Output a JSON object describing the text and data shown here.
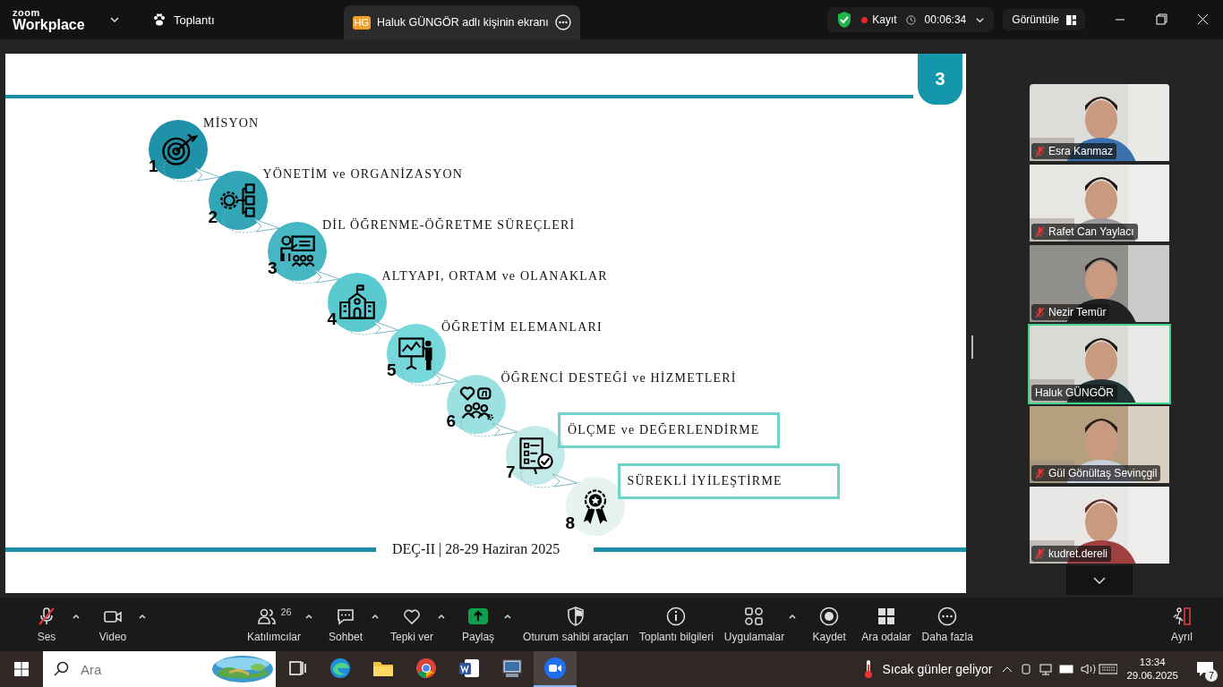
{
  "title_bar": {
    "brand": "zoom",
    "product": "Workplace",
    "meeting_menu": "Toplantı",
    "share_tab": {
      "initials": "HG",
      "label": "Haluk GÜNGÖR adlı kişinin ekranı"
    },
    "recording": {
      "label": "Kayıt",
      "elapsed": "00:06:34"
    },
    "view_button": "Görüntüle"
  },
  "slide": {
    "page_number": "3",
    "footer": "DEÇ-II | 28-29 Haziran 2025",
    "items": [
      {
        "number": "1",
        "label": "MİSYON",
        "kind": "target",
        "boxed": false
      },
      {
        "number": "2",
        "label": "YÖNETİM ve ORGANİZASYON",
        "kind": "organization",
        "boxed": false
      },
      {
        "number": "3",
        "label": "DİL ÖĞRENME-ÖĞRETME SÜREÇLERİ",
        "kind": "teacher",
        "boxed": false
      },
      {
        "number": "4",
        "label": "ALTYAPI, ORTAM ve OLANAKLAR",
        "kind": "school",
        "boxed": false
      },
      {
        "number": "5",
        "label": "ÖĞRETİM ELEMANLARI",
        "kind": "presenter",
        "boxed": false
      },
      {
        "number": "6",
        "label": "ÖĞRENCİ DESTEĞİ ve HİZMETLERİ",
        "kind": "support",
        "boxed": false
      },
      {
        "number": "7",
        "label": "ÖLÇME ve DEĞERLENDİRME",
        "kind": "checklist",
        "boxed": true
      },
      {
        "number": "8",
        "label": "SÜREKLİ İYİLEŞTİRME",
        "kind": "award",
        "boxed": true
      }
    ]
  },
  "participants": [
    {
      "name": "Esra Kanmaz",
      "muted": true,
      "speaking": false
    },
    {
      "name": "Rafet Can Yaylacı",
      "muted": true,
      "speaking": false
    },
    {
      "name": "Nezir Temür",
      "muted": true,
      "speaking": false
    },
    {
      "name": "Haluk GÜNGÖR",
      "muted": false,
      "speaking": true
    },
    {
      "name": "Gül Gönültaş Sevinçgil",
      "muted": true,
      "speaking": false
    },
    {
      "name": "kudret.dereli",
      "muted": true,
      "speaking": false
    }
  ],
  "toolbar": [
    {
      "label": "Ses",
      "kind": "mic",
      "muted": true,
      "menu": true
    },
    {
      "label": "Video",
      "kind": "video",
      "menu": true
    },
    {
      "label": "Katılımcılar",
      "kind": "participants",
      "count": "26",
      "menu": true
    },
    {
      "label": "Sohbet",
      "kind": "chat",
      "menu": true
    },
    {
      "label": "Tepki ver",
      "kind": "react",
      "menu": true
    },
    {
      "label": "Paylaş",
      "kind": "share",
      "menu": true
    },
    {
      "label": "Oturum sahibi araçları",
      "kind": "host"
    },
    {
      "label": "Toplantı bilgileri",
      "kind": "info"
    },
    {
      "label": "Uygulamalar",
      "kind": "apps",
      "menu": true
    },
    {
      "label": "Kaydet",
      "kind": "record"
    },
    {
      "label": "Ara odalar",
      "kind": "rooms"
    },
    {
      "label": "Daha fazla",
      "kind": "more"
    },
    {
      "label": "Ayrıl",
      "kind": "leave"
    }
  ],
  "taskbar": {
    "search_placeholder": "Ara",
    "apps": [
      {
        "kind": "taskview",
        "active": false
      },
      {
        "kind": "edge",
        "active": false
      },
      {
        "kind": "explorer",
        "active": false
      },
      {
        "kind": "chrome",
        "active": false
      },
      {
        "kind": "word",
        "active": false
      },
      {
        "kind": "computer",
        "active": false
      },
      {
        "kind": "zoom",
        "active": true
      }
    ],
    "weather": "Sıcak günler geliyor",
    "time": "13:34",
    "date": "29.06.2025",
    "notifications": "7"
  }
}
